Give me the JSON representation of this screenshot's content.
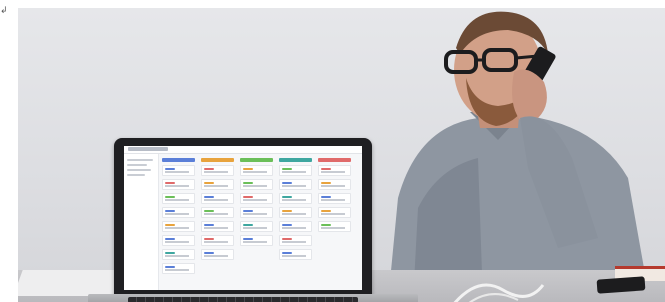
{
  "image": {
    "kind": "photo",
    "subject": "man-on-phone-with-laptop",
    "icons": {
      "corner_mark": "corner-mark-icon"
    },
    "colors": {
      "wall": "#dfe0e4",
      "shirt": "#8d95a0",
      "laptop": "#1f1f22",
      "screen": "#f6f7f9"
    }
  },
  "screen": {
    "column_tag_colors": [
      "#5b7fd8",
      "#e8a33d",
      "#6bbf59",
      "#3fa7a0",
      "#e06a6a"
    ]
  }
}
